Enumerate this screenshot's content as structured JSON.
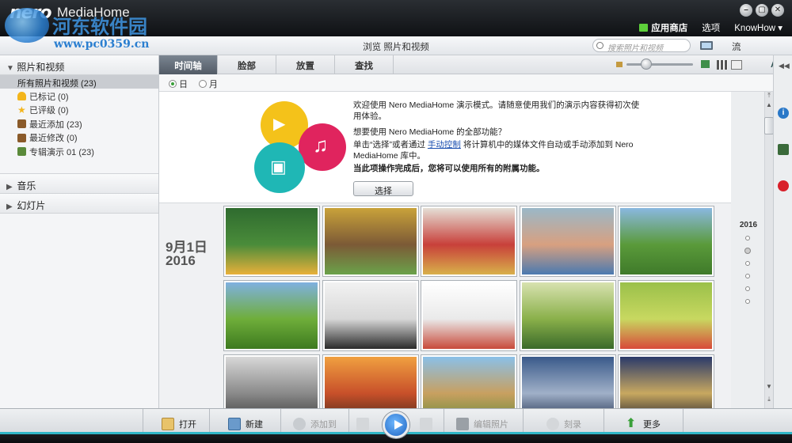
{
  "window": {
    "logo": "nero",
    "app_name": "MediaHome",
    "watermark_title": "河东软件园",
    "watermark_url": "www.pc0359.cn",
    "min_label": "–",
    "max_label": "▢",
    "close_label": "✕",
    "menu": {
      "store": "应用商店",
      "options": "选项",
      "knowhow": "KnowHow ▾"
    }
  },
  "browsebar": {
    "title": "浏览 照片和视频",
    "search_placeholder": "搜索照片和视频",
    "stream": "流"
  },
  "sidebar": {
    "photos_section": "照片和视频",
    "items": [
      {
        "label": "所有照片和视频 (23)",
        "icon": "none"
      },
      {
        "label": "已标记 (0)",
        "icon": "flag-icon"
      },
      {
        "label": "已评级 (0)",
        "icon": "star-icon"
      },
      {
        "label": "最近添加 (23)",
        "icon": "recent-icon"
      },
      {
        "label": "最近修改 (0)",
        "icon": "modified-icon"
      },
      {
        "label": "专辑演示 01 (23)",
        "icon": "album-icon"
      }
    ],
    "music_section": "音乐",
    "slideshow_section": "幻灯片"
  },
  "tabs": [
    "时间轴",
    "脸部",
    "放置",
    "查找"
  ],
  "day_month": {
    "day": "日",
    "month": "月"
  },
  "promo": {
    "line1": "欢迎使用 Nero MediaHome 演示模式。请随意使用我们的演示内容获得初次使用体验。",
    "line2": "想要使用 Nero MediaHome 的全部功能？",
    "line3_pre": "单击“选择”或者通过 ",
    "line3_link": "手动控制",
    "line3_post": " 将计算机中的媒体文件自动或手动添加到 Nero MediaHome 库中。",
    "line4": "当此项操作完成后，您将可以使用所有的附属功能。",
    "button": "选择"
  },
  "timeline": {
    "date_line1": "9月1日",
    "date_line2": "2016",
    "year": "2016"
  },
  "photos": [
    {
      "desc": "school kids",
      "colors": [
        "#2f6b2f",
        "#4a8c3a",
        "#e8b03a"
      ]
    },
    {
      "desc": "group of children",
      "colors": [
        "#c9a23a",
        "#7c5a36",
        "#6aa24a"
      ]
    },
    {
      "desc": "kids drawing",
      "colors": [
        "#e5dfd6",
        "#c8403a",
        "#d8b04a"
      ]
    },
    {
      "desc": "kids smiling",
      "colors": [
        "#9ab8c8",
        "#d8a080",
        "#4a7ab0"
      ]
    },
    {
      "desc": "kids running in field",
      "colors": [
        "#8ab8e0",
        "#5a9a3a",
        "#3f7a2a"
      ]
    },
    {
      "desc": "children running on meadow",
      "colors": [
        "#7fb0e0",
        "#6fae3a",
        "#3d7a1f"
      ]
    },
    {
      "desc": "karate kids",
      "colors": [
        "#f2f2f2",
        "#d8d8d8",
        "#2a2a2a"
      ]
    },
    {
      "desc": "karate kids white",
      "colors": [
        "#ffffff",
        "#eaeaea",
        "#c84a3a"
      ]
    },
    {
      "desc": "kids playing football",
      "colors": [
        "#d8e2b0",
        "#8ab04a",
        "#3a6a2a"
      ]
    },
    {
      "desc": "kids with ball",
      "colors": [
        "#9ac04a",
        "#c8d860",
        "#d84a3a"
      ]
    },
    {
      "desc": "mountain black and white",
      "colors": [
        "#d8d8d8",
        "#8a8a8a",
        "#3a3a3a"
      ]
    },
    {
      "desc": "sunset desert",
      "colors": [
        "#f0a040",
        "#c8502a",
        "#4a2a1a"
      ]
    },
    {
      "desc": "giraffes",
      "colors": [
        "#8ac0e8",
        "#c8a060",
        "#6a8a3a"
      ]
    },
    {
      "desc": "city night",
      "colors": [
        "#3a5a8a",
        "#a0b0c8",
        "#1a2a4a"
      ]
    },
    {
      "desc": "brandenburg gate",
      "colors": [
        "#2a3a6a",
        "#c8a860",
        "#1a1a2a"
      ]
    }
  ],
  "bottombar": {
    "open": "打开",
    "new": "新建",
    "add_to": "添加到",
    "edit_photo": "编辑照片",
    "burn": "刻录",
    "more": "更多"
  },
  "colors": {
    "accent": "#2fb6c7",
    "active_tab": "#5f6873",
    "link": "#1b4fb0"
  }
}
